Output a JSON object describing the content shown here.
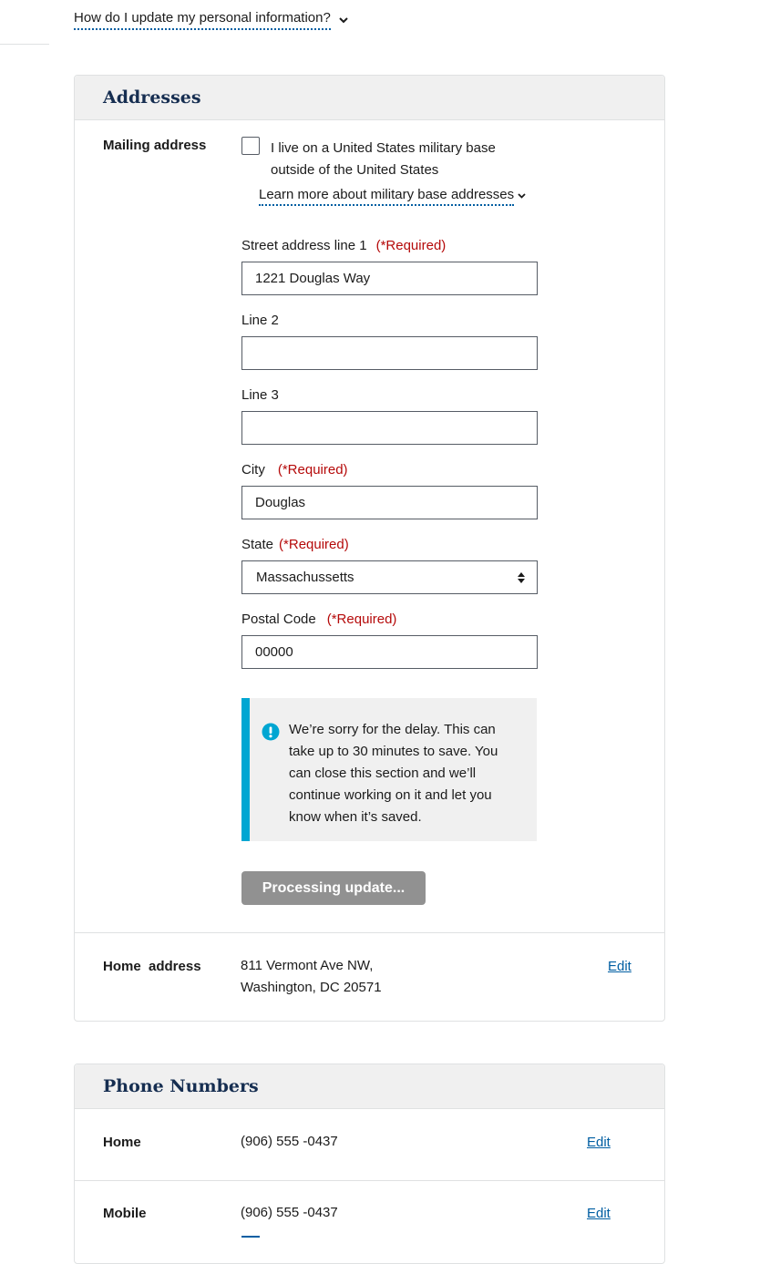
{
  "faq": {
    "label": "How do I update my personal information?"
  },
  "addresses": {
    "title": "Addresses",
    "mailing": {
      "label": "Mailing address",
      "military_checkbox_label": "I live on a United States military base outside of the United States",
      "learn_more": "Learn more about military base addresses",
      "required_text": "(*Required)",
      "street1": {
        "label": "Street address line 1",
        "value": "1221 Douglas Way"
      },
      "line2": {
        "label": "Line 2",
        "value": ""
      },
      "line3": {
        "label": "Line 3",
        "value": ""
      },
      "city": {
        "label": "City",
        "value": "Douglas"
      },
      "state": {
        "label": "State",
        "value": "Massachussetts"
      },
      "postal": {
        "label": "Postal Code",
        "value": "00000"
      },
      "alert_text": "We’re sorry for the delay.  This can take up to 30 minutes to save.  You can close this section and we’ll continue working on it and let you know when it’s saved.",
      "button_label": "Processing update..."
    },
    "home": {
      "label": "Home  address",
      "line1": "811 Vermont Ave NW,",
      "line2": "Washington, DC 20571",
      "edit": "Edit"
    }
  },
  "phones": {
    "title": "Phone Numbers",
    "items": [
      {
        "label": "Home",
        "value": "(906) 555 -0437",
        "edit": "Edit"
      },
      {
        "label": "Mobile",
        "value": "(906) 555 -0437",
        "edit": "Edit"
      }
    ]
  },
  "colors": {
    "link": "#005ea2",
    "required": "#b50909",
    "alert_bar": "#00a6d2",
    "title": "#162e51"
  }
}
